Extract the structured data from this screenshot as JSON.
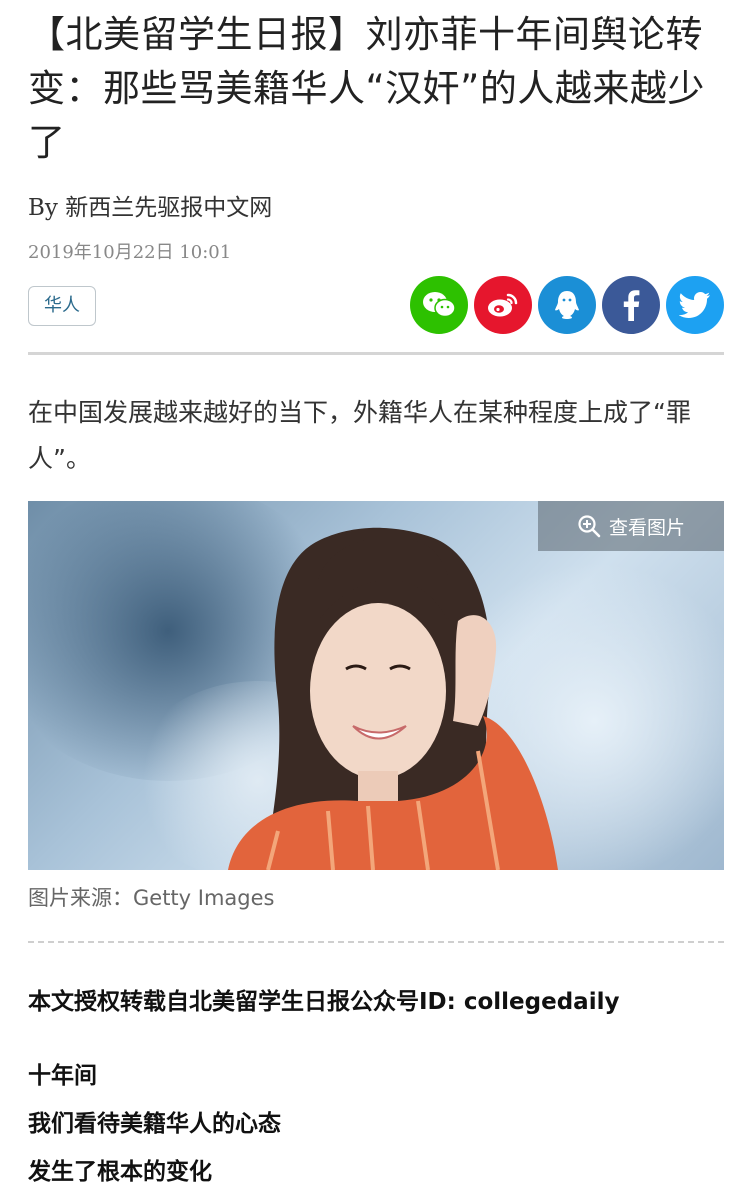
{
  "article": {
    "title": "【北美留学生日报】刘亦菲十年间舆论转变：那些骂美籍华人“汉奸”的人越来越少了",
    "byline": "By 新西兰先驱报中文网",
    "date": "2019年10月22日 10:01",
    "tag": "华人",
    "lead": "在中国发展越来越好的当下，外籍华人在某种程度上成了“罪人”。",
    "view_image_label": "查看图片",
    "image_caption": "图片来源：Getty Images",
    "source_note": "本文授权转载自北美留学生日报公众号ID: collegedaily",
    "body_lines": [
      "十年间",
      "我们看待美籍华人的心态",
      "发生了根本的变化"
    ]
  },
  "share": {
    "buttons": [
      {
        "icon": "wechat-icon",
        "color": "#2dc100"
      },
      {
        "icon": "weibo-icon",
        "color": "#e6162d"
      },
      {
        "icon": "qq-icon",
        "color": "#1b8fd6"
      },
      {
        "icon": "facebook-icon",
        "color": "#3b5998"
      },
      {
        "icon": "twitter-icon",
        "color": "#1da1f2"
      }
    ]
  }
}
